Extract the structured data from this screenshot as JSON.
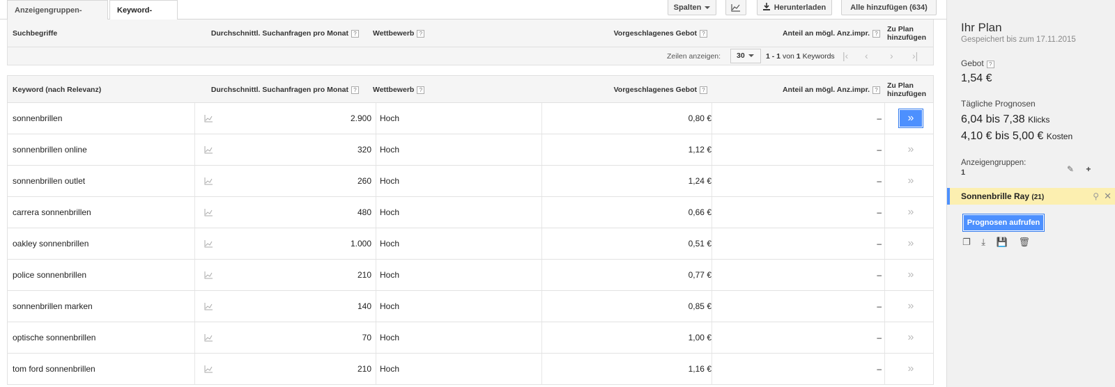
{
  "tabs": [
    {
      "label": "Anzeigengruppen-Ideen"
    },
    {
      "label": "Keyword-Ideen"
    }
  ],
  "toolbar": {
    "columns_label": "Spalten",
    "chart_icon": "chart-icon",
    "download_label": "Herunterladen",
    "add_all_label": "Alle hinzufügen (634)"
  },
  "search_header": {
    "term": "Suchbegriffe",
    "volume": "Durchschnittl. Suchanfragen pro Monat",
    "competition": "Wettbewerb",
    "bid": "Vorgeschlagenes Gebot",
    "share": "Anteil an mögl. Anz.impr.",
    "add_line1": "Zu Plan",
    "add_line2": "hinzufügen",
    "help": "?"
  },
  "pager": {
    "rows_label": "Zeilen anzeigen:",
    "rows_value": "30",
    "range_prefix": "1 - 1",
    "range_of": "von",
    "range_total": "1",
    "range_suffix": "Keywords"
  },
  "keyword_header": {
    "keyword": "Keyword (nach Relevanz)",
    "volume": "Durchschnittl. Suchanfragen pro Monat",
    "competition": "Wettbewerb",
    "bid": "Vorgeschlagenes Gebot",
    "share": "Anteil an mögl. Anz.impr.",
    "add_line1": "Zu Plan",
    "add_line2": "hinzufügen"
  },
  "rows": [
    {
      "keyword": "sonnenbrillen",
      "volume": "2.900",
      "competition": "Hoch",
      "bid": "0,80 €",
      "share": "–"
    },
    {
      "keyword": "sonnenbrillen online",
      "volume": "320",
      "competition": "Hoch",
      "bid": "1,12 €",
      "share": "–"
    },
    {
      "keyword": "sonnenbrillen outlet",
      "volume": "260",
      "competition": "Hoch",
      "bid": "1,24 €",
      "share": "–"
    },
    {
      "keyword": "carrera sonnenbrillen",
      "volume": "480",
      "competition": "Hoch",
      "bid": "0,66 €",
      "share": "–"
    },
    {
      "keyword": "oakley sonnenbrillen",
      "volume": "1.000",
      "competition": "Hoch",
      "bid": "0,51 €",
      "share": "–"
    },
    {
      "keyword": "police sonnenbrillen",
      "volume": "210",
      "competition": "Hoch",
      "bid": "0,77 €",
      "share": "–"
    },
    {
      "keyword": "sonnenbrillen marken",
      "volume": "140",
      "competition": "Hoch",
      "bid": "0,85 €",
      "share": "–"
    },
    {
      "keyword": "optische sonnenbrillen",
      "volume": "70",
      "competition": "Hoch",
      "bid": "1,00 €",
      "share": "–"
    },
    {
      "keyword": "tom ford sonnenbrillen",
      "volume": "210",
      "competition": "Hoch",
      "bid": "1,16 €",
      "share": "–"
    }
  ],
  "add_glyph": "»",
  "sidebar": {
    "title": "Ihr Plan",
    "saved": "Gespeichert bis zum 17.11.2015",
    "bid_label": "Gebot",
    "bid_value": "1,54 €",
    "forecast_label": "Tägliche Prognosen",
    "clicks_range": "6,04 bis 7,38",
    "clicks_unit": "Klicks",
    "cost_range": "4,10 € bis 5,00 €",
    "cost_unit": "Kosten",
    "adgroups_label": "Anzeigengruppen:",
    "adgroups_count": "1",
    "adgroup_name": "Sonnenbrille Ray",
    "adgroup_count": "(21)",
    "forecast_button": "Prognosen aufrufen"
  },
  "colors": {
    "accent": "#4d90fe",
    "highlight": "#fcefb0"
  }
}
